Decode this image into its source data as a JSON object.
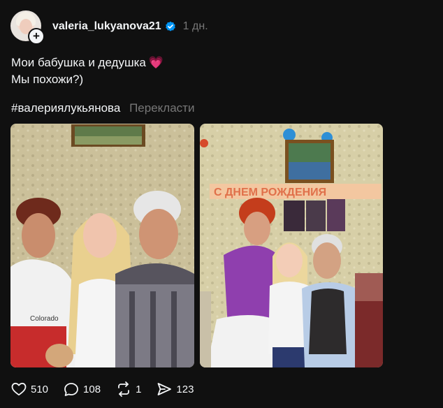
{
  "post": {
    "username": "valeria_lukyanova21",
    "time": "1 дн.",
    "text_line1": "Мои бабушка и дедушка",
    "text_line1_emoji": "💗",
    "text_line2": "Мы похожи?)",
    "hashtag": "#валериялукьянова",
    "translate_label": "Перекласти"
  },
  "icons": {
    "verified": "verified-badge-icon",
    "like": "heart-icon",
    "comment": "comment-bubble-icon",
    "repost": "repost-icon",
    "share": "send-icon"
  },
  "stats": {
    "likes": "510",
    "comments": "108",
    "reposts": "1",
    "shares": "123"
  },
  "colors": {
    "background": "#101010",
    "text": "#f3f5f7",
    "muted": "#777777",
    "verified": "#0095f6",
    "heart_emoji": "#f1467c"
  }
}
